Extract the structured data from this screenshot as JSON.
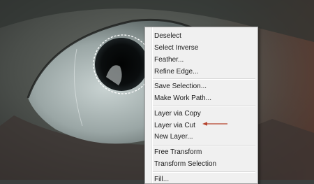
{
  "menu": {
    "groups": [
      {
        "items": [
          {
            "label": "Deselect"
          },
          {
            "label": "Select Inverse"
          },
          {
            "label": "Feather..."
          },
          {
            "label": "Refine Edge..."
          }
        ]
      },
      {
        "items": [
          {
            "label": "Save Selection..."
          },
          {
            "label": "Make Work Path..."
          }
        ]
      },
      {
        "items": [
          {
            "label": "Layer via Copy"
          },
          {
            "label": "Layer via Cut"
          },
          {
            "label": "New Layer..."
          }
        ]
      },
      {
        "items": [
          {
            "label": "Free Transform"
          },
          {
            "label": "Transform Selection"
          }
        ]
      },
      {
        "items": [
          {
            "label": "Fill..."
          }
        ]
      }
    ]
  },
  "annotation": {
    "arrow_color": "#b5432e",
    "points_to": "Layer via Cut"
  }
}
